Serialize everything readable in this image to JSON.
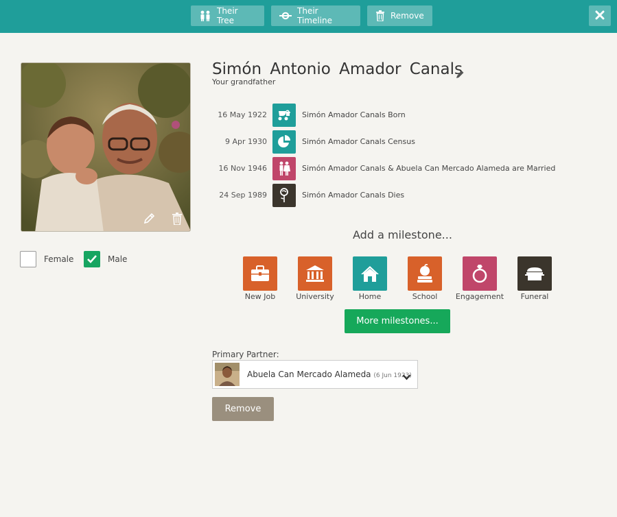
{
  "toolbar": {
    "tree_label": "Their Tree",
    "timeline_label": "Their Timeline",
    "remove_label": "Remove",
    "close_icon": "close-icon"
  },
  "person": {
    "name": "Simón Antonio Amador Canals",
    "relation": "Your grandfather",
    "gender_options": {
      "female": "Female",
      "male": "Male"
    },
    "selected_gender": "Male"
  },
  "events": [
    {
      "date": "16 May 1922",
      "text": "Simón Amador Canals Born",
      "icon": "baby-carriage-icon",
      "color": "#1f9e9a"
    },
    {
      "date": "9 Apr 1930",
      "text": "Simón Amador Canals Census",
      "icon": "pie-chart-icon",
      "color": "#1f9e9a"
    },
    {
      "date": "16 Nov 1946",
      "text": "Simón Amador Canals & Abuela Can Mercado Alameda are Married",
      "icon": "couple-icon",
      "color": "#c0466a"
    },
    {
      "date": "24 Sep 1989",
      "text": "Simón Amador Canals Dies",
      "icon": "rose-icon",
      "color": "#3b352c"
    }
  ],
  "milestones": {
    "heading": "Add a milestone...",
    "items": [
      {
        "label": "New Job",
        "icon": "briefcase-icon",
        "color": "#d8612a"
      },
      {
        "label": "University",
        "icon": "university-icon",
        "color": "#d8612a"
      },
      {
        "label": "Home",
        "icon": "house-icon",
        "color": "#1f9e9a"
      },
      {
        "label": "School",
        "icon": "apple-books-icon",
        "color": "#d8612a"
      },
      {
        "label": "Engagement",
        "icon": "ring-icon",
        "color": "#c0466a"
      },
      {
        "label": "Funeral",
        "icon": "casket-icon",
        "color": "#3b352c"
      }
    ],
    "more_label": "More milestones..."
  },
  "partner": {
    "label": "Primary Partner:",
    "name": "Abuela Can Mercado Alameda",
    "date": "(6 Jun 1923)"
  },
  "remove_button": "Remove",
  "colors": {
    "accent": "#1f9e9a",
    "green": "#16a85a",
    "muted": "#9a8f7e"
  }
}
